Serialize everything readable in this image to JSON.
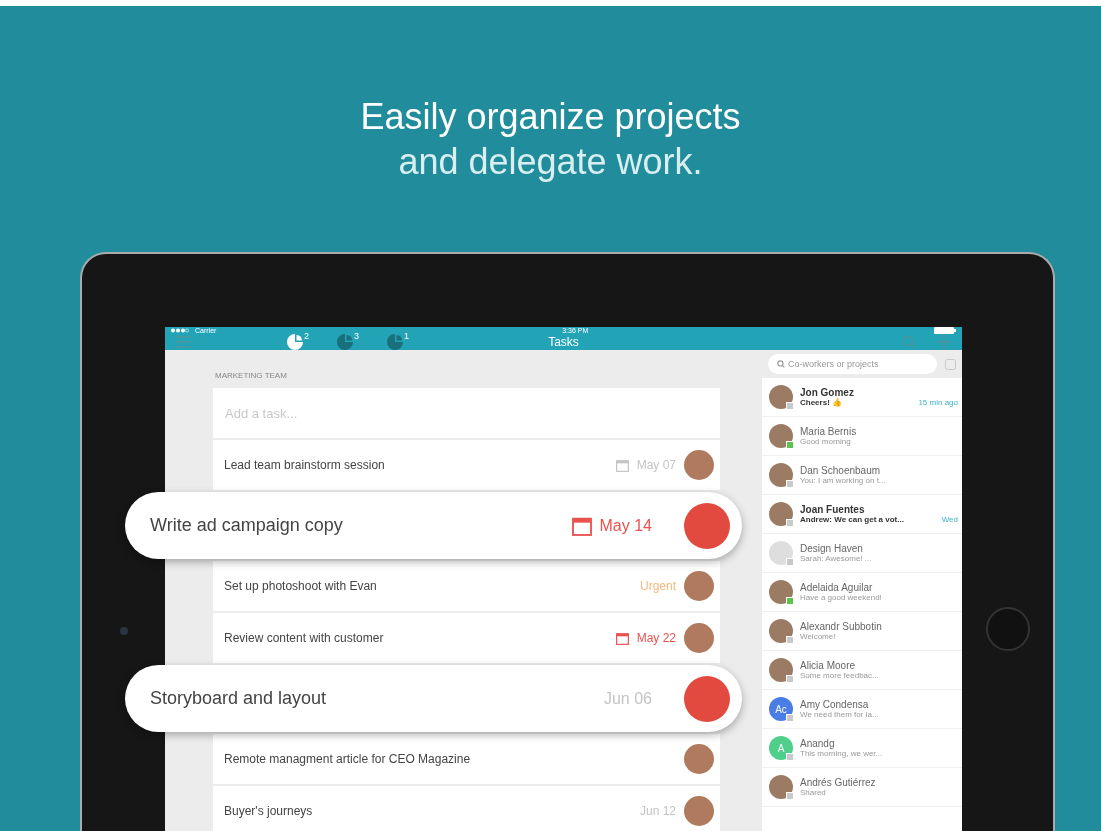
{
  "headline": {
    "title": "Easily organize projects",
    "subtitle": "and delegate work."
  },
  "status_bar": {
    "carrier": "Carrier",
    "time": "3:36 PM"
  },
  "nav": {
    "title": "Tasks",
    "tabs": [
      {
        "badge": "2",
        "selected": true
      },
      {
        "badge": "3",
        "selected": false
      },
      {
        "badge": "1",
        "selected": false
      }
    ]
  },
  "tasks": {
    "section": "MARKETING TEAM",
    "add_placeholder": "Add a task...",
    "items": [
      {
        "title": "Lead team brainstorm session",
        "due": {
          "kind": "date",
          "text": "May 07"
        },
        "highlighted": false
      },
      {
        "title": "Write ad campaign copy",
        "due": {
          "kind": "overdue",
          "text": "May 14"
        },
        "highlighted": true
      },
      {
        "title": "Set up photoshoot with Evan",
        "due": {
          "kind": "urgent",
          "text": "Urgent"
        },
        "highlighted": false
      },
      {
        "title": "Review content with customer",
        "due": {
          "kind": "overdue",
          "text": "May 22"
        },
        "highlighted": false
      },
      {
        "title": "Storyboard and layout",
        "due": {
          "kind": "plain",
          "text": "Jun 06"
        },
        "highlighted": true
      },
      {
        "title": "Remote managment article for CEO Magazine",
        "highlighted": false
      },
      {
        "title": "Buyer's journeys",
        "due": {
          "kind": "plain",
          "text": "Jun 12"
        },
        "highlighted": false
      }
    ]
  },
  "chats": {
    "search_placeholder": "Co-workers or projects",
    "items": [
      {
        "name": "Jon Gomez",
        "preview": "Cheers! 👍",
        "time": "15 min ago",
        "unread": true,
        "online": false
      },
      {
        "name": "Maria Bernis",
        "preview": "Good morning",
        "unread": false,
        "online": true
      },
      {
        "name": "Dan Schoenbaum",
        "preview": "You: I am working on t...",
        "unread": false,
        "online": false
      },
      {
        "name": "Joan Fuentes",
        "preview": "Andrew: We can get a vot...",
        "time": "Wed",
        "unread": true,
        "online": false
      },
      {
        "name": "Design Haven",
        "preview": "Sarah: Awesome! ...",
        "unread": false,
        "online": false,
        "group": true
      },
      {
        "name": "Adelaida Aguilar",
        "preview": "Have a good weekend!",
        "unread": false,
        "online": true
      },
      {
        "name": "Alexandr Subbotin",
        "preview": "Welcome!",
        "unread": false,
        "online": false
      },
      {
        "name": "Alicia Moore",
        "preview": "Some more feedbac...",
        "unread": false,
        "online": false
      },
      {
        "name": "Amy Condensa",
        "preview": "We need them for la...",
        "unread": false,
        "online": false,
        "avatar": {
          "initials": "Ac",
          "color": "#4a7de6"
        }
      },
      {
        "name": "Anandg",
        "preview": "This morning, we wer...",
        "unread": false,
        "online": false,
        "avatar": {
          "initials": "A",
          "color": "#4fcf8a"
        }
      },
      {
        "name": "Andrés Gutiérrez",
        "preview": "Shared",
        "unread": false,
        "online": false
      }
    ]
  }
}
